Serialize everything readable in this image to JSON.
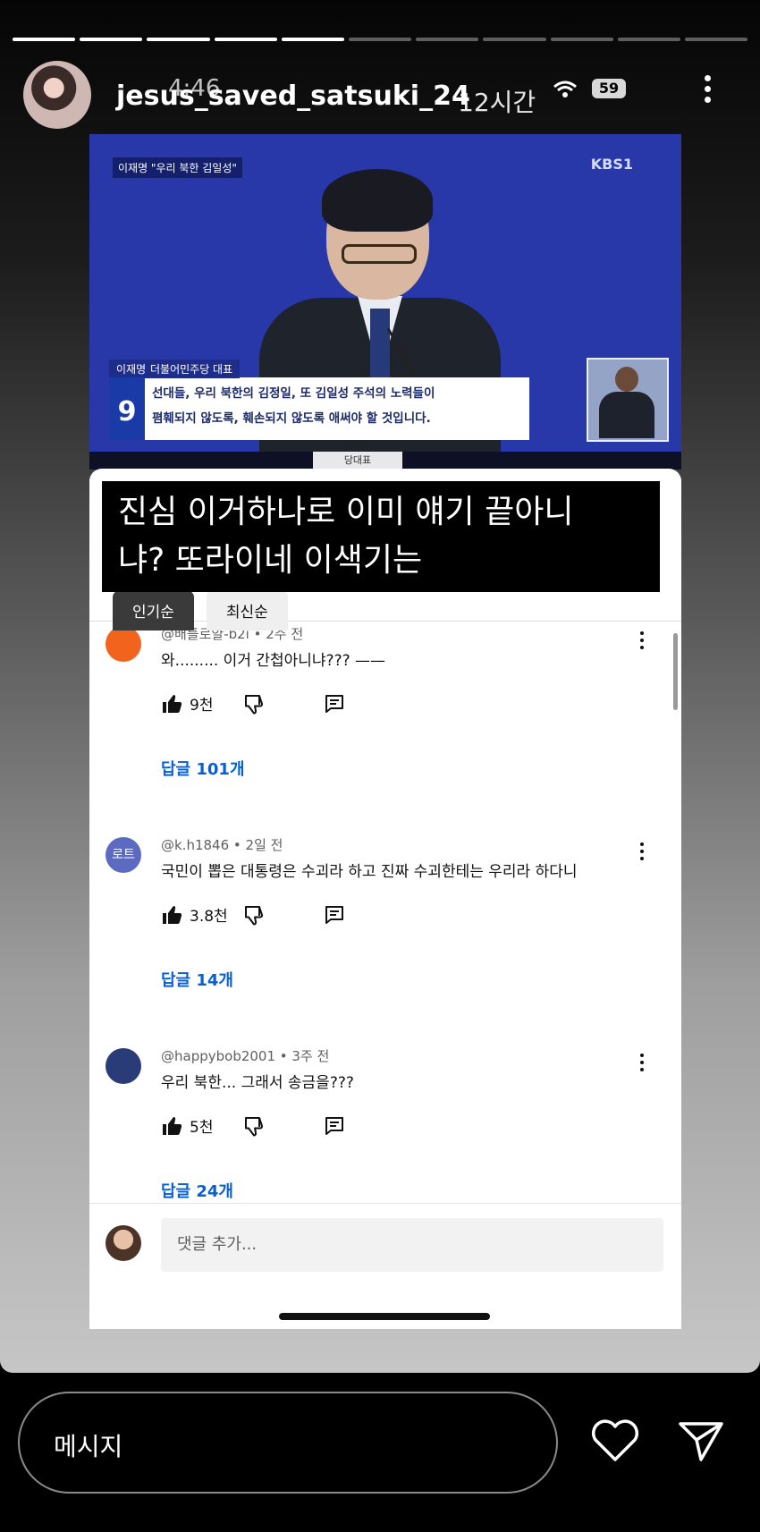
{
  "story": {
    "progress_total": 11,
    "progress_done": 5,
    "username": "jesus_saved_satsuki_24",
    "overlay_time": "4:46",
    "time_ago": "12시간",
    "battery": "59"
  },
  "video": {
    "top_tag": "이재명 \"우리 북한 김일성\"",
    "channel_logo": "KBS1",
    "lower_third_name": "이재명",
    "lower_third_role": "더불어민주당 대표",
    "badge": "9",
    "subtitle_line1": "선대들, 우리 북한의 김정일, 또 김일성 주석의 노력들이",
    "subtitle_line2": "폄훼되지 않도록, 훼손되지 않도록 애써야 할 것입니다.",
    "nameplate": "당대표"
  },
  "caption": {
    "line1": "진심 이거하나로 이미 얘기 끝아니",
    "line2": "냐? 또라이네 이색기는"
  },
  "sort_tabs": [
    "인기순",
    "최신순"
  ],
  "comments": [
    {
      "author": "@배틀로얄-b2i",
      "time": "2주 전",
      "text": "와......... 이거 간첩아니냐??? ——",
      "likes": "9천",
      "replies": "답글 101개",
      "avatar_text": "",
      "avatar_color": "#f2641e"
    },
    {
      "author": "@k.h1846",
      "time": "2일 전",
      "text": "국민이 뽑은 대통령은 수괴라 하고  진짜 수괴한테는 우리라 하다니",
      "likes": "3.8천",
      "replies": "답글 14개",
      "avatar_text": "로트",
      "avatar_color": "#5c6bc0"
    },
    {
      "author": "@happybob2001",
      "time": "3주 전",
      "text": "우리 북한... 그래서 송금을???",
      "likes": "5천",
      "replies": "답글 24개",
      "avatar_text": "",
      "avatar_color": "#2a3c78"
    }
  ],
  "add_comment_placeholder": "댓글 추가...",
  "message_placeholder": "메시지",
  "icons": {
    "like": "thumbs-up-icon",
    "dislike": "thumbs-down-icon",
    "reply": "reply-icon",
    "heart": "heart-icon",
    "send": "send-icon",
    "more": "more-vertical-icon",
    "wifi": "wifi-icon"
  }
}
